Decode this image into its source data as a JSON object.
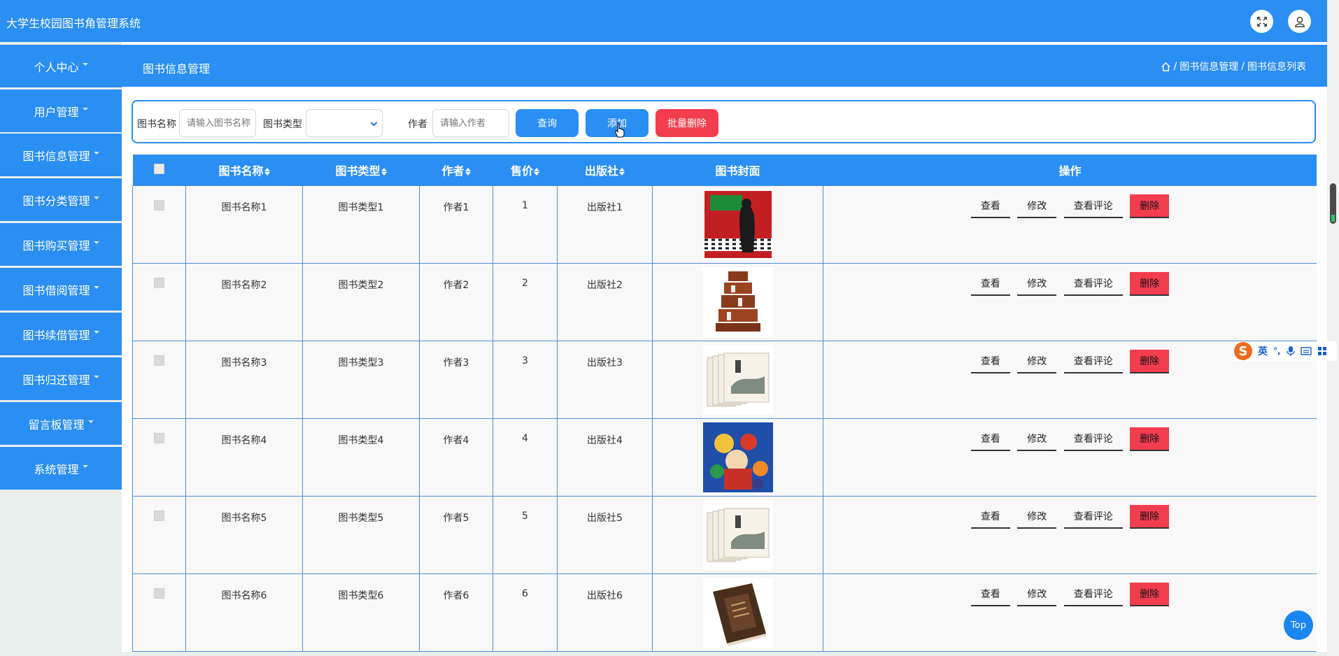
{
  "app_title": "大学生校园图书角管理系统",
  "sidebar": {
    "items": [
      {
        "label": "个人中心"
      },
      {
        "label": "用户管理"
      },
      {
        "label": "图书信息管理"
      },
      {
        "label": "图书分类管理"
      },
      {
        "label": "图书购买管理"
      },
      {
        "label": "图书借阅管理"
      },
      {
        "label": "图书续借管理"
      },
      {
        "label": "图书归还管理"
      },
      {
        "label": "留言板管理"
      },
      {
        "label": "系统管理"
      }
    ]
  },
  "header": {
    "title": "图书信息管理",
    "breadcrumb": [
      "图书信息管理",
      "图书信息列表"
    ]
  },
  "filter": {
    "name_label": "图书名称",
    "name_placeholder": "请输入图书名称",
    "type_label": "图书类型",
    "type_value": "",
    "author_label": "作者",
    "author_placeholder": "请输入作者",
    "search_button": "查询",
    "add_button": "添加",
    "batch_delete_button": "批量删除"
  },
  "table": {
    "columns": [
      "图书名称",
      "图书类型",
      "作者",
      "售价",
      "出版社",
      "图书封面",
      "操作"
    ],
    "rows": [
      {
        "name": "图书名称1",
        "type": "图书类型1",
        "author": "作者1",
        "price": "1",
        "publisher": "出版社1",
        "cover": "red-book-cover"
      },
      {
        "name": "图书名称2",
        "type": "图书类型2",
        "author": "作者2",
        "price": "2",
        "publisher": "出版社2",
        "cover": "wooden-shelf"
      },
      {
        "name": "图书名称3",
        "type": "图书类型3",
        "author": "作者3",
        "price": "3",
        "publisher": "出版社3",
        "cover": "book-set"
      },
      {
        "name": "图书名称4",
        "type": "图书类型4",
        "author": "作者4",
        "price": "4",
        "publisher": "出版社4",
        "cover": "anime-cover"
      },
      {
        "name": "图书名称5",
        "type": "图书类型5",
        "author": "作者5",
        "price": "5",
        "publisher": "出版社5",
        "cover": "book-set"
      },
      {
        "name": "图书名称6",
        "type": "图书类型6",
        "author": "作者6",
        "price": "6",
        "publisher": "出版社6",
        "cover": "old-book"
      }
    ],
    "row_actions": {
      "view": "查看",
      "edit": "修改",
      "comments": "查看评论",
      "delete": "删除"
    }
  },
  "ime": {
    "lang": "英"
  },
  "top_button": "Top",
  "colors": {
    "primary": "#2a8ef2",
    "danger": "#f23d4f",
    "sidebar_bg": "#e8efec"
  }
}
